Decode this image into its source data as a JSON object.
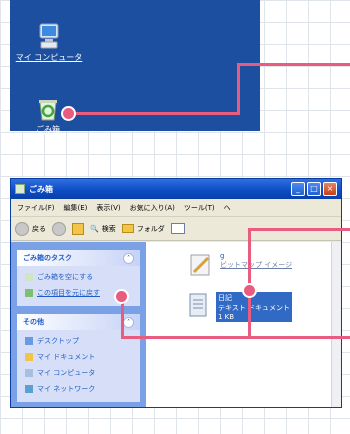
{
  "desktop": {
    "icons": [
      {
        "label": "マイ コンピュータ"
      },
      {
        "label": "ごみ箱"
      }
    ]
  },
  "window": {
    "title": "ごみ箱",
    "menu": [
      "ファイル(F)",
      "編集(E)",
      "表示(V)",
      "お気に入り(A)",
      "ツール(T)",
      "ヘ"
    ],
    "toolbar": {
      "back": "戻る",
      "search": "検索",
      "folders": "フォルダ"
    },
    "task_pane": {
      "recycle_tasks": {
        "title": "ごみ箱のタスク",
        "items": [
          "ごみ箱を空にする",
          "この項目を元に戻す"
        ]
      },
      "other_places": {
        "title": "その他",
        "items": [
          "デスクトップ",
          "マイ ドキュメント",
          "マイ コンピュータ",
          "マイ ネットワーク"
        ]
      }
    },
    "files": [
      {
        "name": "g",
        "type": "ビットマップ イメージ",
        "size": ""
      },
      {
        "name": "日記",
        "type": "テキスト ドキュメント",
        "size": "1 KB"
      }
    ]
  },
  "colors": {
    "accent": "#e85d7f",
    "desktop": "#1d4fa0"
  }
}
